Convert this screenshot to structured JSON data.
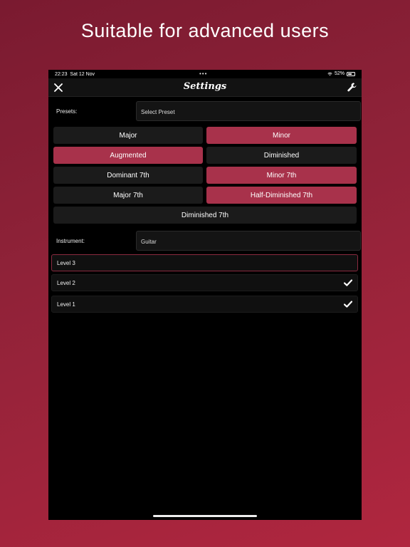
{
  "headline": "Suitable for advanced users",
  "status": {
    "time": "22:23",
    "date": "Sat 12 Nov",
    "dots": "•••",
    "battery": "52%"
  },
  "nav": {
    "title": "Settings",
    "close_icon": "close-icon",
    "right_icon": "wrench-icon"
  },
  "presets": {
    "label": "Presets:",
    "value": "Select Preset"
  },
  "chords": [
    {
      "label": "Major",
      "active": false
    },
    {
      "label": "Minor",
      "active": true
    },
    {
      "label": "Augmented",
      "active": true
    },
    {
      "label": "Diminished",
      "active": false
    },
    {
      "label": "Dominant 7th",
      "active": false
    },
    {
      "label": "Minor 7th",
      "active": true
    },
    {
      "label": "Major 7th",
      "active": false
    },
    {
      "label": "Half-Diminished 7th",
      "active": true
    },
    {
      "label": "Diminished 7th",
      "active": false
    }
  ],
  "instrument": {
    "label": "Instrument:",
    "value": "Guitar"
  },
  "levels": [
    {
      "label": "Level 3",
      "checked": false
    },
    {
      "label": "Level 2",
      "checked": true
    },
    {
      "label": "Level 1",
      "checked": true
    }
  ],
  "colors": {
    "accent": "#a8324b",
    "button_bg": "#1b1b1b"
  }
}
